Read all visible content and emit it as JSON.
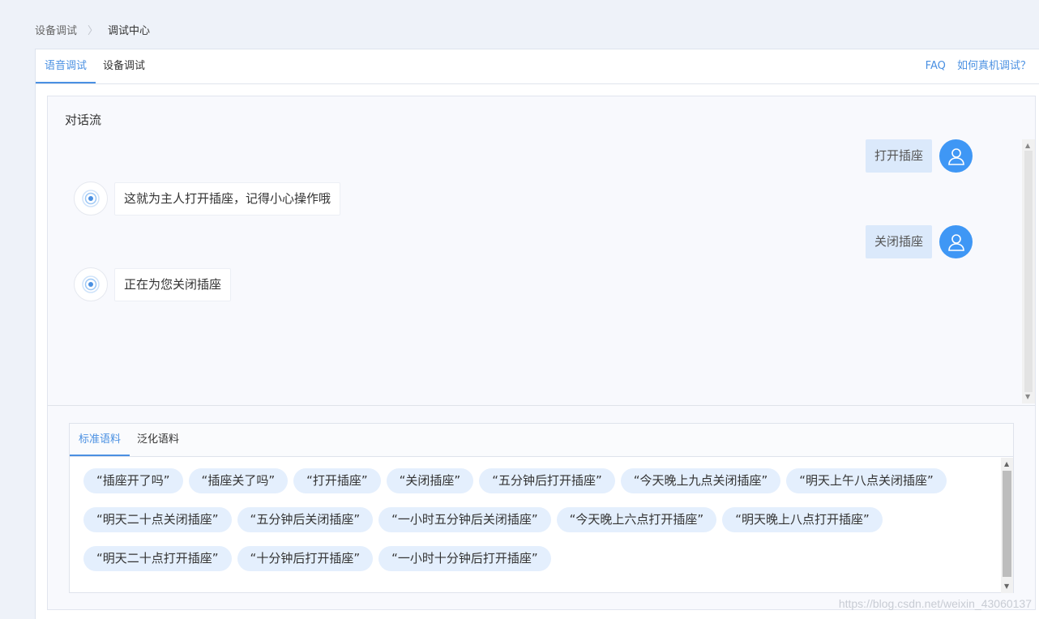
{
  "breadcrumb": {
    "parent": "设备调试",
    "separator": "〉",
    "current": "调试中心"
  },
  "tabs": [
    {
      "label": "语音调试",
      "active": true
    },
    {
      "label": "设备调试",
      "active": false
    }
  ],
  "help_links": {
    "faq": "FAQ",
    "real_device": "如何真机调试？"
  },
  "dialog": {
    "title": "对话流",
    "messages": [
      {
        "from": "user",
        "text": "打开插座"
      },
      {
        "from": "bot",
        "text": "这就为主人打开插座，记得小心操作哦"
      },
      {
        "from": "user",
        "text": "关闭插座"
      },
      {
        "from": "bot",
        "text": "正在为您关闭插座"
      }
    ]
  },
  "corpus": {
    "tabs": [
      {
        "label": "标准语料",
        "active": true
      },
      {
        "label": "泛化语料",
        "active": false
      }
    ],
    "chips": [
      "“插座开了吗”",
      "“插座关了吗”",
      "“打开插座”",
      "“关闭插座”",
      "“五分钟后打开插座”",
      "“今天晚上九点关闭插座”",
      "“明天上午八点关闭插座”",
      "“明天二十点关闭插座”",
      "“五分钟后关闭插座”",
      "“一小时五分钟后关闭插座”",
      "“今天晚上六点打开插座”",
      "“明天晚上八点打开插座”",
      "“明天二十点打开插座”",
      "“十分钟后打开插座”",
      "“一小时十分钟后打开插座”"
    ]
  },
  "watermark": "https://blog.csdn.net/weixin_43060137",
  "colors": {
    "accent": "#4a90e2",
    "avatar": "#3f97f5",
    "user_bubble": "#dbe9fb",
    "chip": "#e4effd"
  },
  "icons": {
    "user_avatar": "user-icon",
    "bot_avatar": "bot-radar-icon"
  }
}
